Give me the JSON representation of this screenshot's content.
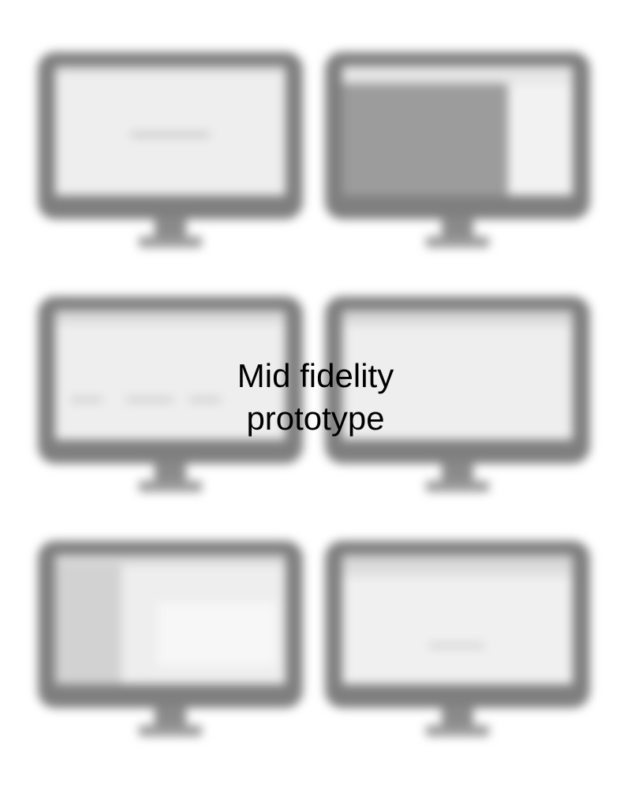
{
  "caption": {
    "line1": "Mid fidelity",
    "line2": "prototype"
  },
  "wireframes": [
    {
      "id": "screen-1",
      "row": 1,
      "column": 1
    },
    {
      "id": "screen-2",
      "row": 1,
      "column": 2
    },
    {
      "id": "screen-3",
      "row": 2,
      "column": 1
    },
    {
      "id": "screen-4",
      "row": 2,
      "column": 2
    },
    {
      "id": "screen-5",
      "row": 3,
      "column": 1
    },
    {
      "id": "screen-6",
      "row": 3,
      "column": 2
    }
  ],
  "colors": {
    "background": "#ffffff",
    "bezel": "#7f7f7f",
    "screen": "#eeeeee",
    "caption": "#000000"
  }
}
